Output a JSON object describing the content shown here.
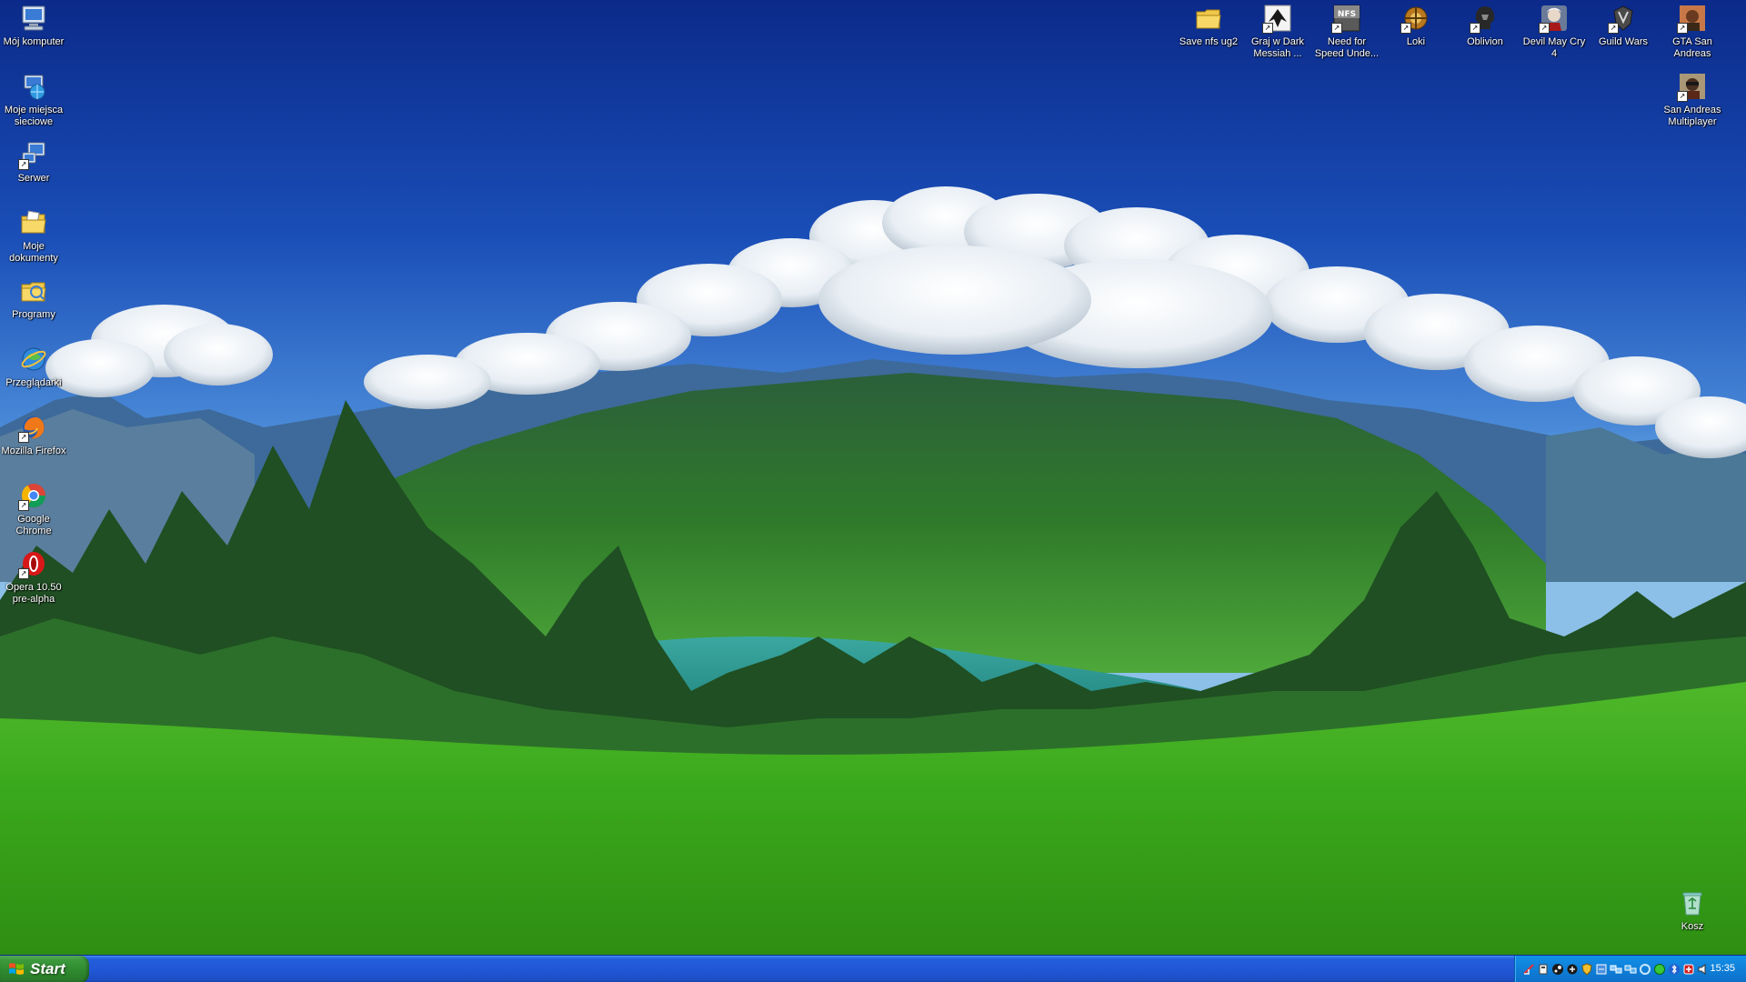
{
  "left_icons": [
    {
      "id": "my-computer",
      "label": "Mój komputer",
      "icon": "computer-icon"
    },
    {
      "id": "network-places",
      "label": "Moje miejsca sieciowe",
      "icon": "network-places-icon"
    },
    {
      "id": "server",
      "label": "Serwer",
      "icon": "server-icon"
    },
    {
      "id": "my-documents",
      "label": "Moje dokumenty",
      "icon": "documents-folder-icon"
    },
    {
      "id": "programs",
      "label": "Programy",
      "icon": "programs-folder-icon"
    },
    {
      "id": "browsers",
      "label": "Przeglądarki",
      "icon": "browsers-icon"
    },
    {
      "id": "firefox",
      "label": "Mozilla Firefox",
      "icon": "firefox-icon"
    },
    {
      "id": "chrome",
      "label": "Google Chrome",
      "icon": "chrome-icon"
    },
    {
      "id": "opera",
      "label": "Opera 10.50 pre-alpha",
      "icon": "opera-icon"
    }
  ],
  "top_icons": [
    {
      "id": "save-nfs",
      "label": "Save nfs ug2",
      "icon": "folder-icon"
    },
    {
      "id": "dark-messiah",
      "label": "Graj w Dark Messiah ...",
      "icon": "dark-messiah-icon"
    },
    {
      "id": "nfs-underground",
      "label": "Need for Speed Unde...",
      "icon": "nfs-icon"
    },
    {
      "id": "loki",
      "label": "Loki",
      "icon": "loki-icon"
    },
    {
      "id": "oblivion",
      "label": "Oblivion",
      "icon": "oblivion-icon"
    },
    {
      "id": "devil-may-cry",
      "label": "Devil May Cry 4",
      "icon": "devil-may-cry-icon"
    },
    {
      "id": "guild-wars",
      "label": "Guild Wars",
      "icon": "guild-wars-icon"
    },
    {
      "id": "gta-sa",
      "label": "GTA San Andreas",
      "icon": "gta-icon"
    }
  ],
  "right_icons": [
    {
      "id": "sa-mp",
      "label": "San Andreas Multiplayer",
      "icon": "samp-icon"
    },
    {
      "id": "recycle-bin",
      "label": "Kosz",
      "icon": "recycle-bin-icon"
    }
  ],
  "taskbar": {
    "start_label": "Start",
    "clock": "15:35",
    "tray_icons": [
      "network-icon",
      "shield-icon",
      "steam-icon",
      "skype-icon",
      "security-icon",
      "update-icon",
      "connection-icon",
      "volume-control-icon",
      "sync-icon",
      "messenger-icon",
      "bluetooth-icon",
      "antivirus-icon",
      "speaker-icon"
    ]
  },
  "colors": {
    "taskbar_blue": "#245edb",
    "start_green": "#3c9a3c",
    "tray_blue": "#0f7fd8"
  }
}
